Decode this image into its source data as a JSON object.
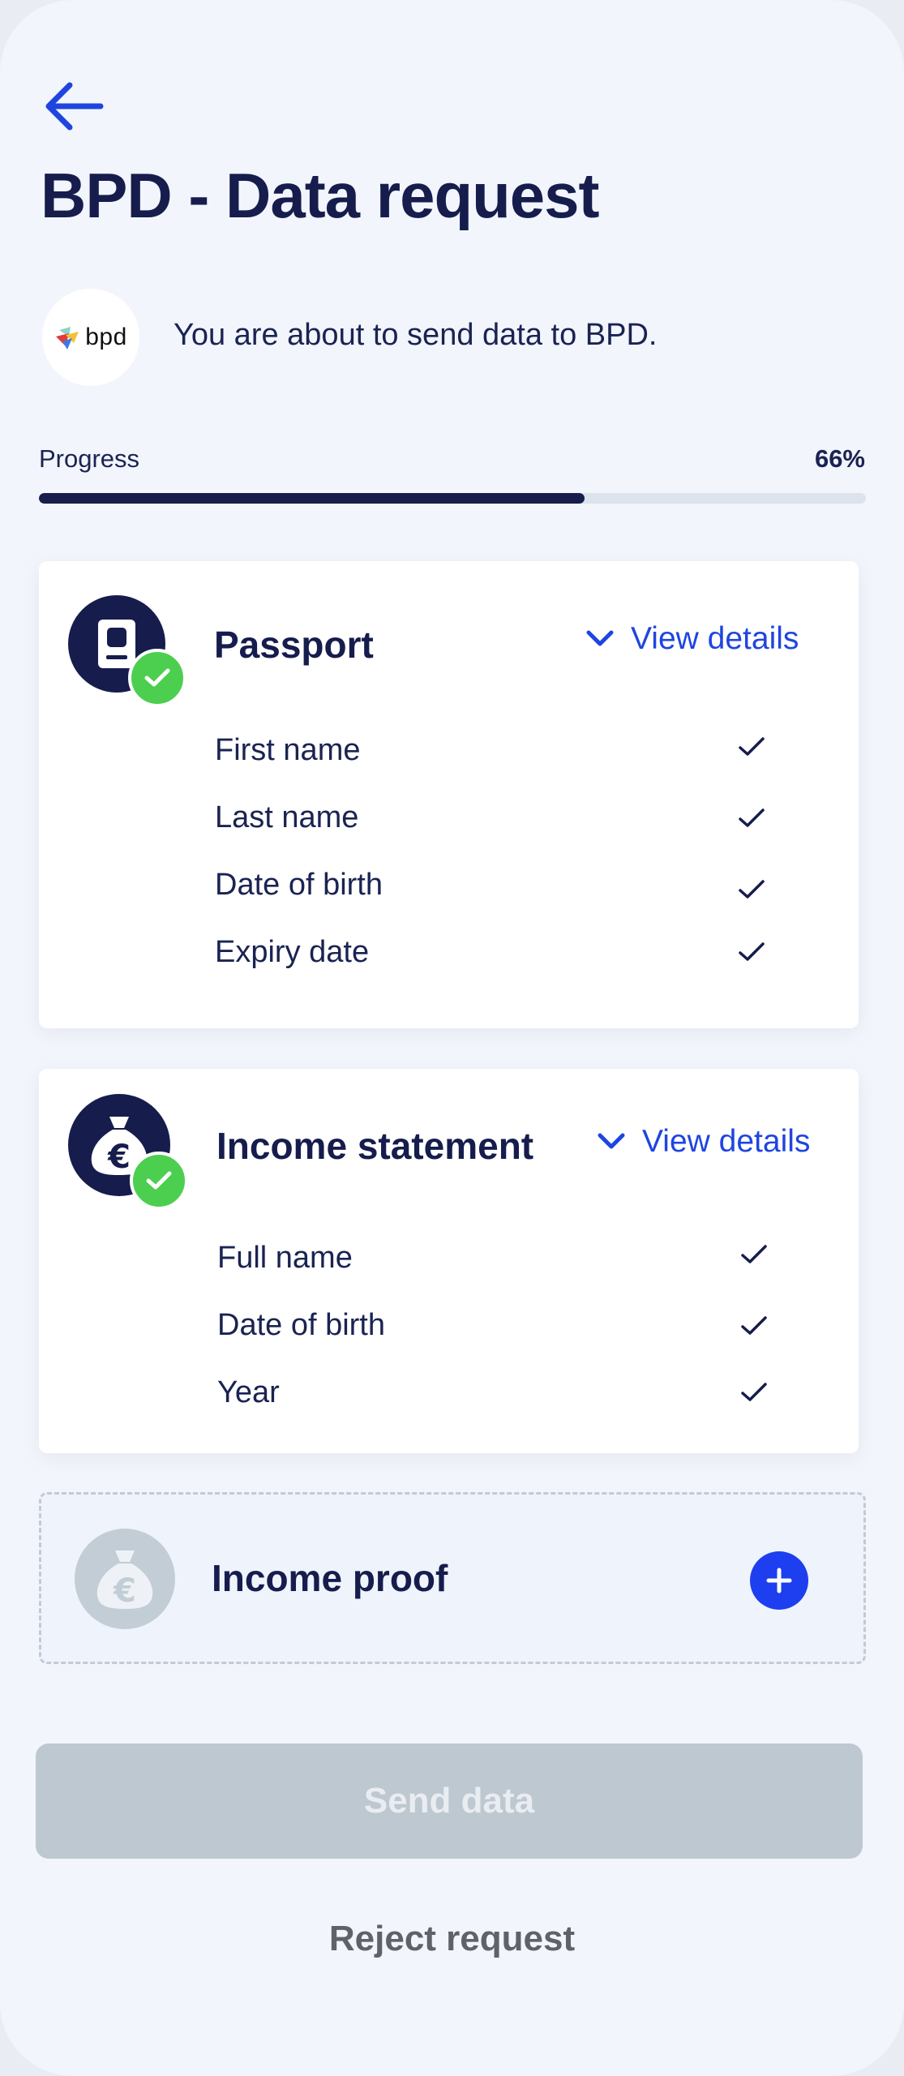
{
  "header": {
    "back_icon": "arrow-left-icon",
    "title": "BPD - Data request"
  },
  "requester": {
    "logo_text": "bpd",
    "message": "You are about to send data to BPD."
  },
  "progress": {
    "label": "Progress",
    "percent_text": "66%",
    "value": 0.66
  },
  "cards": {
    "passport": {
      "title": "Passport",
      "icon": "passport-icon",
      "status_icon": "check-badge-icon",
      "view_details": "View details",
      "fields": [
        "First name",
        "Last name",
        "Date of birth",
        "Expiry date"
      ]
    },
    "income_statement": {
      "title": "Income statement",
      "icon": "money-bag-euro-icon",
      "status_icon": "check-badge-icon",
      "view_details": "View details",
      "fields": [
        "Full name",
        "Date of birth",
        "Year"
      ]
    },
    "income_proof": {
      "title": "Income proof",
      "icon": "money-bag-euro-icon",
      "add_icon": "plus-icon"
    }
  },
  "actions": {
    "send": "Send data",
    "reject": "Reject request"
  },
  "colors": {
    "navy": "#161d4d",
    "accent_blue": "#1f45e0",
    "success_green": "#4ccf4f",
    "disabled_gray": "#bec8d0",
    "background": "#f2f5fb"
  }
}
